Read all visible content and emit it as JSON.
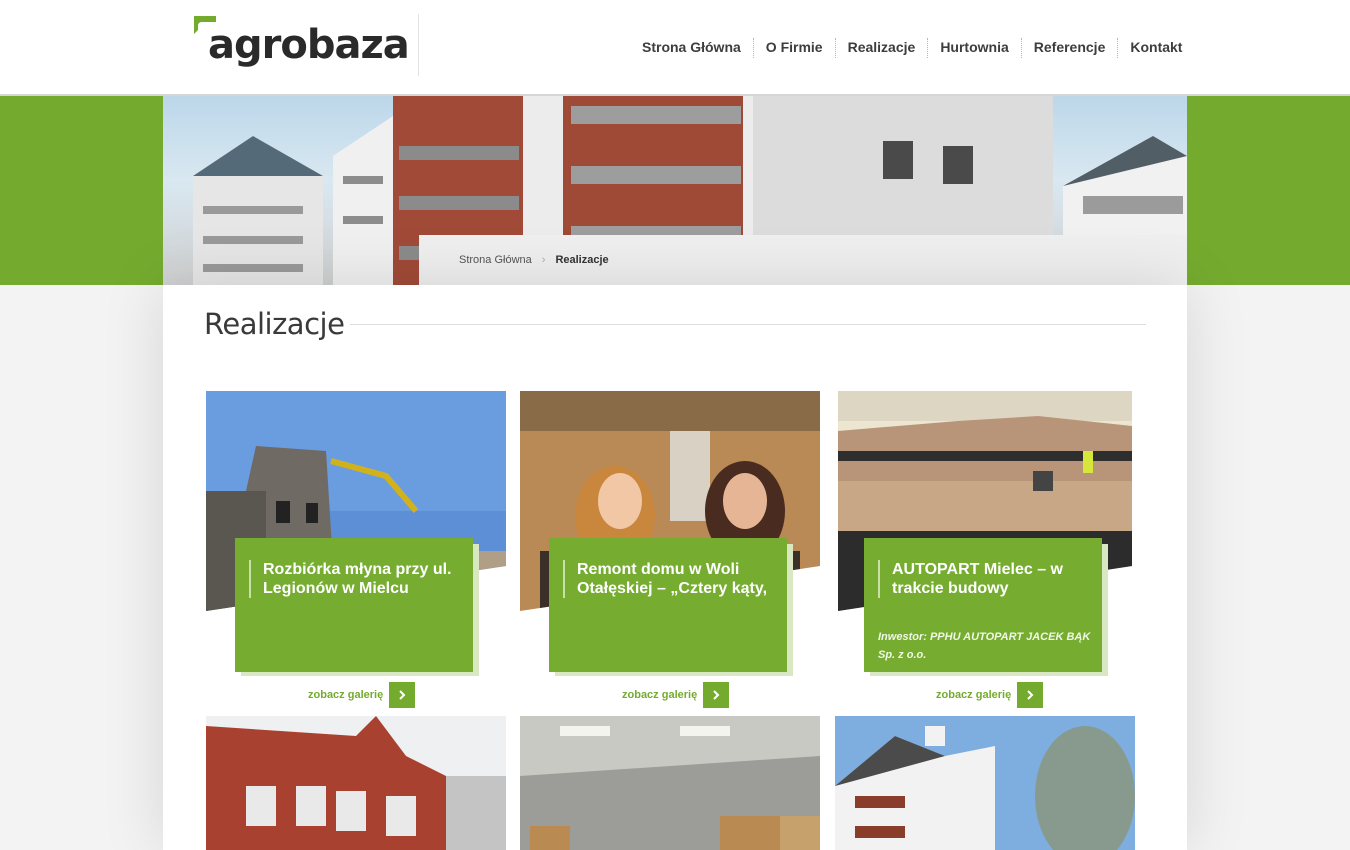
{
  "header": {
    "logo_text": "agrobaza",
    "nav": [
      "Strona Główna",
      "O Firmie",
      "Realizacje",
      "Hurtownia",
      "Referencje",
      "Kontakt"
    ]
  },
  "breadcrumb": {
    "home": "Strona Główna",
    "current": "Realizacje",
    "separator": "›"
  },
  "page_title": "Realizacje",
  "cards": [
    {
      "title": "Rozbiórka młyna przy ul. Legionów w Mielcu",
      "subtitle": "",
      "link": "zobacz galerię"
    },
    {
      "title": "Remont domu w Woli Otałęskiej – „Cztery kąty,",
      "subtitle": "",
      "link": "zobacz galerię"
    },
    {
      "title": "AUTOPART Mielec – w trakcie budowy",
      "subtitle": "Inwestor: PPHU AUTOPART JACEK BĄK Sp. z o.o.",
      "link": "zobacz galerię"
    }
  ],
  "colors": {
    "brand_green": "#74ab2e",
    "panel_green": "#76ad30",
    "text_dark": "#3d3d3d"
  }
}
